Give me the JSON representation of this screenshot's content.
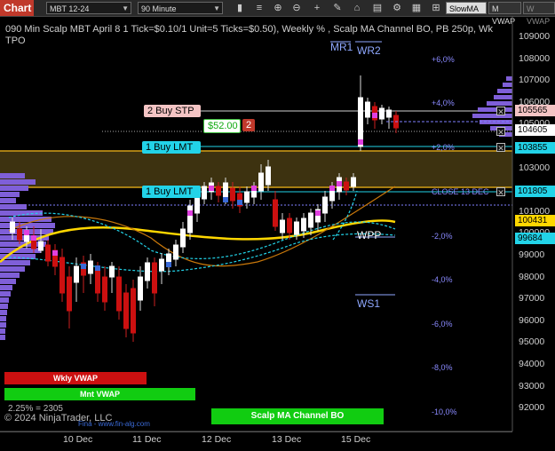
{
  "toolbar": {
    "chart_tab": "Chart",
    "instrument": "MBT 12-24",
    "interval": "90 Minute",
    "indicator_select": "SlowMA",
    "button_m_vwap": "M VWAP",
    "button_w_vwap": "W VWAP"
  },
  "chart": {
    "title": "090 Min Scalp MBT April 8 1 Tick=$0.10/1 Unit=5 Ticks=$0.50), Weekly % , Scalp MA Channel BO, PB 250p, Wk TPO",
    "price_axis": [
      "109000",
      "108000",
      "107000",
      "106000",
      "105000",
      "104000",
      "103000",
      "102000",
      "101000",
      "100000",
      "99000",
      "98000",
      "97000",
      "96000",
      "95000",
      "94000",
      "93000",
      "92000"
    ],
    "date_axis": [
      "10 Dec",
      "11 Dec",
      "12 Dec",
      "13 Dec",
      "15 Dec"
    ],
    "percent_levels": [
      "+6,0%",
      "+4,0%",
      "+2,0%",
      "-2,0%",
      "-4,0%",
      "-6,0%",
      "-8,0%",
      "-10,0%"
    ],
    "levels": {
      "mr1": "MR1",
      "wr2": "WR2",
      "wpp": "WPP",
      "ws1": "WS1",
      "close_label": "CLOSE 13 DEC"
    },
    "orders": {
      "buy_stp": "2 Buy STP",
      "pnl": "$52.00",
      "qty": "2",
      "buy_lmt_1": "1 Buy LMT",
      "buy_lmt_2": "1 Buy LMT"
    },
    "price_tags": [
      "105565",
      "104605",
      "103855",
      "101805",
      "100431",
      "99684"
    ],
    "bottom": {
      "wkly_vwap": "Wkly VWAP",
      "mnt_vwap": "Mnt VWAP",
      "ma_channel": "Scalp MA Channel BO",
      "stat_text": "2.25% = 2305",
      "copyright": "© 2024 NinjaTrader, LLC",
      "source": "Fina - www.fin-alg.com"
    },
    "colors": {
      "accent_red": "#c0392b",
      "buy_lmt": "#22d3e8",
      "buy_stp": "#f4c4c4",
      "pnl_green": "#3cbf3c",
      "vwap_red": "#cc1010",
      "vwap_green": "#11cc11"
    }
  },
  "chart_data": {
    "type": "candlestick",
    "x": [
      "10 Dec",
      "11 Dec",
      "12 Dec",
      "13 Dec",
      "15 Dec"
    ],
    "ylim": [
      91500,
      109500
    ],
    "series": [
      {
        "values": [
          99800,
          97000,
          102200,
          100400,
          104600
        ]
      }
    ]
  }
}
